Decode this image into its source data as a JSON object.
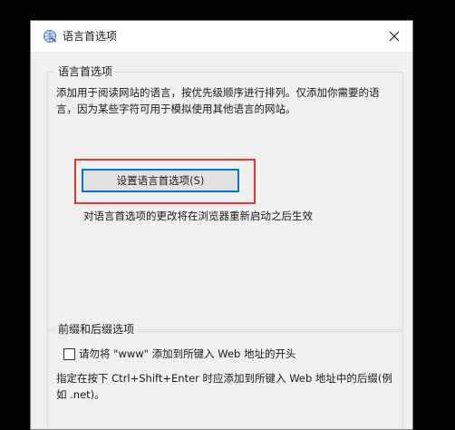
{
  "window": {
    "title": "语言首选项",
    "close_glyph": "✕"
  },
  "language_group": {
    "title": "语言首选项",
    "description": "添加用于阅读网站的语言，按优先级顺序进行排列。仅添加你需要的语言，因为某些字符可用于模拟使用其他语言的网站。",
    "set_button_label": "设置语言首选项(S)",
    "note": "对语言首选项的更改将在浏览器重新启动之后生效"
  },
  "prefix_suffix_group": {
    "title": "前缀和后缀选项",
    "checkbox_label": "请勿将 \"www\" 添加到所键入 Web 地址的开头",
    "checkbox_checked": false,
    "description": "指定在按下 Ctrl+Shift+Enter 时应添加到所键入 Web 地址中的后缀(例如 .net)。"
  },
  "colors": {
    "highlight": "#d9373a",
    "accent": "#0078d7",
    "dialog_bg": "#f0f0f0"
  },
  "icons": {
    "app": "internet-options-globe-icon",
    "close": "close-icon"
  }
}
